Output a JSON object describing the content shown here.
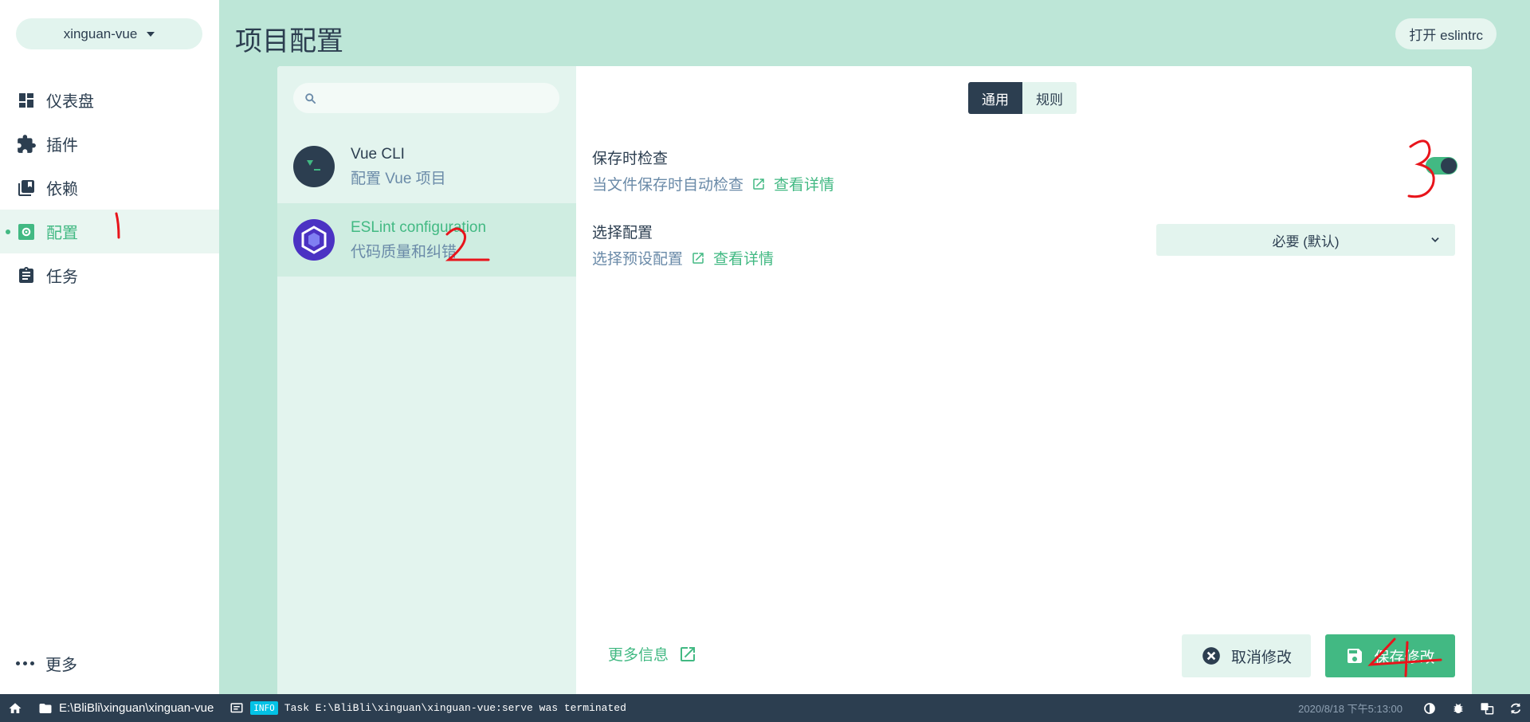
{
  "sidebar": {
    "project": "xinguan-vue",
    "items": [
      {
        "label": "仪表盘",
        "icon": "dashboard-icon"
      },
      {
        "label": "插件",
        "icon": "puzzle-icon"
      },
      {
        "label": "依赖",
        "icon": "library-icon"
      },
      {
        "label": "配置",
        "icon": "settings-icon",
        "active": true
      },
      {
        "label": "任务",
        "icon": "clipboard-icon"
      }
    ],
    "more": "更多"
  },
  "header": {
    "title": "项目配置",
    "open_eslintrc": "打开 eslintrc"
  },
  "list": {
    "search_placeholder": "",
    "items": [
      {
        "name": "Vue CLI",
        "desc": "配置 Vue 项目"
      },
      {
        "name": "ESLint configuration",
        "desc": "代码质量和纠错",
        "selected": true
      }
    ]
  },
  "detail": {
    "tabs": [
      {
        "label": "通用",
        "active": true
      },
      {
        "label": "规则",
        "active": false
      }
    ],
    "prompts": [
      {
        "label": "保存时检查",
        "desc": "当文件保存时自动检查",
        "link": "查看详情",
        "value": true
      },
      {
        "label": "选择配置",
        "desc": "选择预设配置",
        "link": "查看详情",
        "selected_option": "必要 (默认)"
      }
    ],
    "more_info": "更多信息",
    "cancel": "取消修改",
    "save": "保存修改"
  },
  "statusbar": {
    "path": "E:\\BliBli\\xinguan\\xinguan-vue",
    "badge": "INFO",
    "message": "Task E:\\BliBli\\xinguan\\xinguan-vue:serve was terminated",
    "time": "2020/8/18 下午5:13:00"
  },
  "annotations": [
    "1",
    "2",
    "3",
    "4"
  ],
  "colors": {
    "accent": "#42b983",
    "dark": "#2c3e50",
    "bg": "#bde6d7",
    "eslint": "#4b32c3",
    "annotation": "#e8141b"
  }
}
